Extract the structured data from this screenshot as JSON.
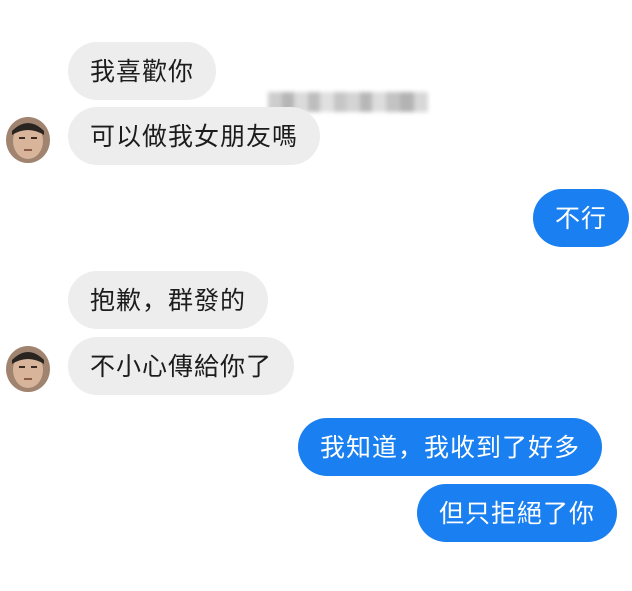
{
  "messages": [
    {
      "side": "incoming",
      "text": "我喜歡你"
    },
    {
      "side": "incoming",
      "text": "可以做我女朋友嗎"
    },
    {
      "side": "outgoing",
      "text": "不行"
    },
    {
      "side": "incoming",
      "text": "抱歉，群發的"
    },
    {
      "side": "incoming",
      "text": "不小心傳給你了"
    },
    {
      "side": "outgoing",
      "text": "我知道，我收到了好多"
    },
    {
      "side": "outgoing",
      "text": "但只拒絕了你"
    }
  ],
  "colors": {
    "incoming_bubble": "#ededed",
    "outgoing_bubble": "#1a7ff0",
    "incoming_text": "#1c1c1c",
    "outgoing_text": "#ffffff"
  }
}
